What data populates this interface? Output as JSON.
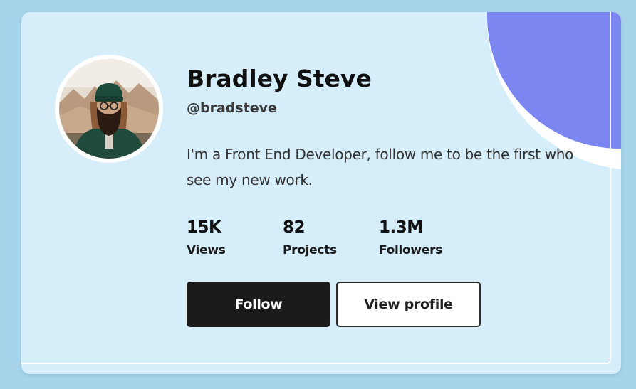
{
  "profile": {
    "name": "Bradley Steve",
    "handle": "@bradsteve",
    "bio": "I'm a Front End Developer, follow me to be the first who see my new work.",
    "avatar_alt": "Profile photo of a bearded man wearing a green beanie and glasses"
  },
  "stats": [
    {
      "value": "15K",
      "label": "Views"
    },
    {
      "value": "82",
      "label": "Projects"
    },
    {
      "value": "1.3M",
      "label": "Followers"
    }
  ],
  "actions": {
    "follow_label": "Follow",
    "view_profile_label": "View profile"
  },
  "colors": {
    "page_background": "#a7d4ea",
    "card_background": "#d6edfa",
    "accent_blob": "#7b86f1",
    "primary_button": "#1b1b1b"
  }
}
